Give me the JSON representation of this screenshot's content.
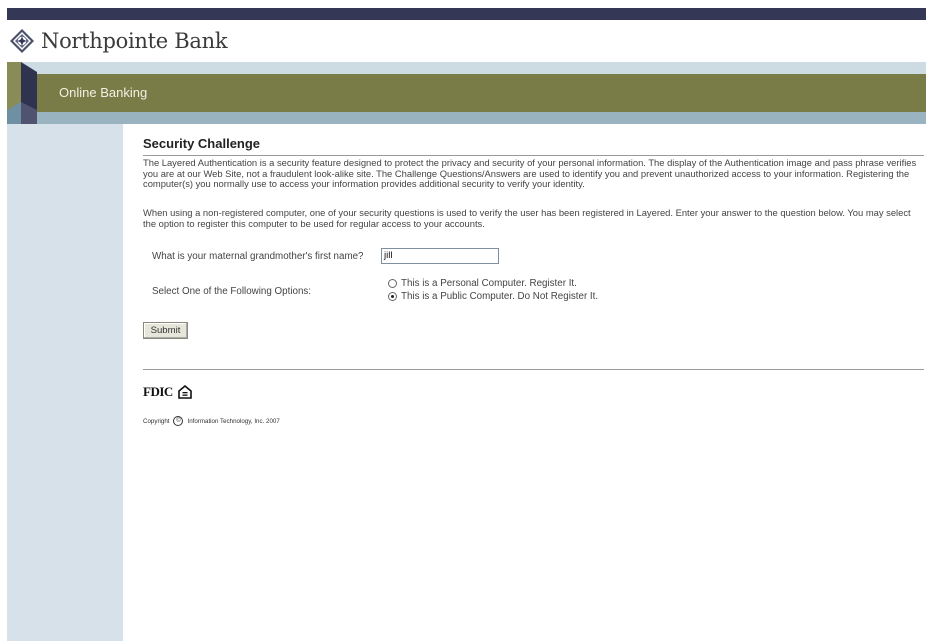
{
  "brand": {
    "name": "Northpointe Bank",
    "logo_icon": "diamond-compass-icon"
  },
  "banner": {
    "section_label": "Online Banking"
  },
  "main": {
    "heading": "Security Challenge",
    "paragraph1": "The Layered Authentication is a security feature designed to protect the privacy and security of your personal information. The display of the Authentication image and pass phrase verifies you are at our Web Site, not a fraudulent look-alike site. The Challenge Questions/Answers are used to identify you and prevent unauthorized access to your information. Registering the computer(s) you normally use to access your information provides additional security to verify your identity.",
    "paragraph2": "When using a non-registered computer, one of your security questions is used to verify the user has been registered in Layered. Enter your answer to the question below. You may select the option to register this computer to be used for regular access to your accounts.",
    "question_label": "What is your maternal grandmother's first name?",
    "answer_value": "jill",
    "options_label": "Select One of the Following Options:",
    "options": [
      {
        "label": "This is a Personal Computer. Register It.",
        "selected": false
      },
      {
        "label": "This is a Public Computer. Do Not Register It.",
        "selected": true
      }
    ],
    "submit_label": "Submit"
  },
  "footer": {
    "fdic_label": "FDIC",
    "equal_housing_icon": "equal-housing-icon",
    "copyright_prefix": "Copyright",
    "copyright_symbol": "©",
    "copyright_text": "Information Technology, Inc. 2007"
  },
  "colors": {
    "top_bar": "#343756",
    "olive_band": "#7a7c48",
    "light_band": "#cddbe3",
    "blue_band": "#9ab3c1",
    "sidebar": "#d6e1e9"
  }
}
